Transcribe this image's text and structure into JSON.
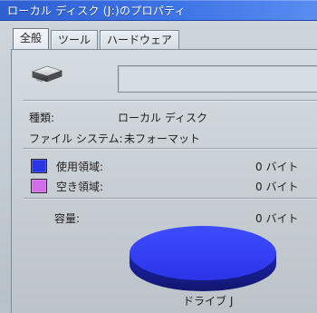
{
  "window": {
    "title": "ローカル ディスク (J:)のプロパティ"
  },
  "tabs": [
    {
      "label": "全般"
    },
    {
      "label": "ツール"
    },
    {
      "label": "ハードウェア"
    }
  ],
  "general": {
    "name_value": "",
    "type": {
      "label": "種類:",
      "value": "ローカル ディスク"
    },
    "filesystem": {
      "label": "ファイル システム:",
      "value": "未フォーマット"
    },
    "used": {
      "label": "使用領域:",
      "value": "0 バイト",
      "color": "#2a35e6"
    },
    "free": {
      "label": "空き領域:",
      "value": "0 バイト",
      "color": "#d36ce8"
    },
    "capacity": {
      "label": "容量:",
      "value": "0 バイト"
    },
    "drive_caption": "ドライブ J"
  },
  "icons": {
    "drive": "hard-drive-icon"
  }
}
